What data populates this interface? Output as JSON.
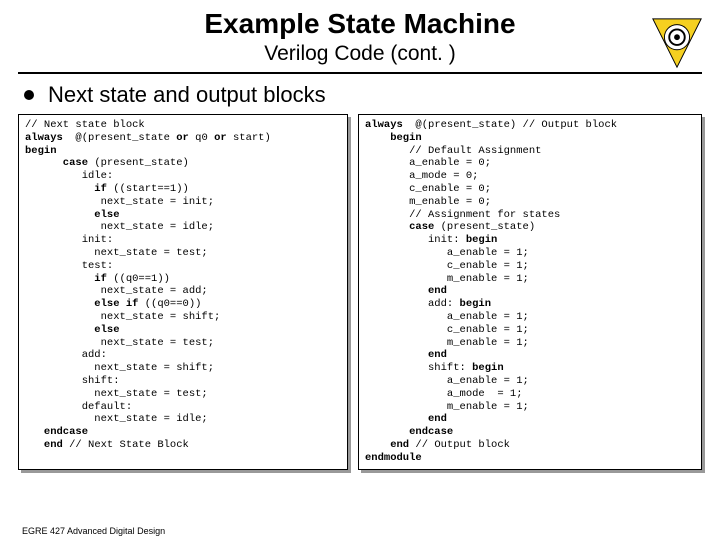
{
  "header": {
    "title": "Example State Machine",
    "subtitle": "Verilog Code (cont. )"
  },
  "bullet": {
    "text": "Next state and output blocks"
  },
  "code_left": {
    "l1": "// Next state block",
    "l2a": "always",
    "l2b": "  @(present_state ",
    "l2c": "or",
    "l2d": " q0 ",
    "l2e": "or",
    "l2f": " start)",
    "l3": "begin",
    "l4a": "      case",
    "l4b": " (present_state)",
    "l5": "         idle:",
    "l6a": "           if",
    "l6b": " ((start==1))",
    "l7": "            next_state = init;",
    "l8": "           else",
    "l9": "            next_state = idle;",
    "l10": "         init:",
    "l11": "           next_state = test;",
    "l12": "         test:",
    "l13a": "           if",
    "l13b": " ((q0==1))",
    "l14": "            next_state = add;",
    "l15a": "           else if",
    "l15b": " ((q0==0))",
    "l16": "            next_state = shift;",
    "l17": "           else",
    "l18": "            next_state = test;",
    "l19": "         add:",
    "l20": "           next_state = shift;",
    "l21": "         shift:",
    "l22": "           next_state = test;",
    "l23": "         default:",
    "l24": "           next_state = idle;",
    "l25": "   endcase",
    "l26a": "   end",
    "l26b": " // Next State Block"
  },
  "code_right": {
    "l1a": "always",
    "l1b": "  @(present_state) // Output block",
    "l2": "    begin",
    "l3": "       // Default Assignment",
    "l4": "       a_enable = 0;",
    "l5": "       a_mode = 0;",
    "l6": "       c_enable = 0;",
    "l7": "       m_enable = 0;",
    "l8": "       // Assignment for states",
    "l9a": "       case",
    "l9b": " (present_state)",
    "l10a": "          init: ",
    "l10b": "begin",
    "l11": "             a_enable = 1;",
    "l12": "             c_enable = 1;",
    "l13": "             m_enable = 1;",
    "l14": "          end",
    "l15a": "          add: ",
    "l15b": "begin",
    "l16": "             a_enable = 1;",
    "l17": "             c_enable = 1;",
    "l18": "             m_enable = 1;",
    "l19": "          end",
    "l20a": "          shift: ",
    "l20b": "begin",
    "l21": "             a_enable = 1;",
    "l22": "             a_mode  = 1;",
    "l23": "             m_enable = 1;",
    "l24": "          end",
    "l25": "       endcase",
    "l26a": "    end",
    "l26b": " // Output block",
    "l27": "endmodule"
  },
  "footer": {
    "text": "EGRE 427 Advanced Digital Design"
  }
}
